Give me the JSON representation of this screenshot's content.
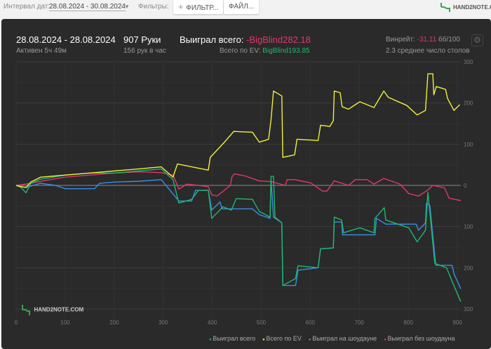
{
  "toolbar": {
    "interval_label": "Интервал дат:",
    "interval_value": "28.08.2024 - 30.08.2024",
    "filters_label": "Фильтры:",
    "filter_button": "ФИЛЬТР...",
    "file_button": "ФАЙЛ...",
    "brand": "HAND2NOTE.C"
  },
  "summary": {
    "date_range": "28.08.2024 - 28.08.2024",
    "active": "Активен 5ч 49м",
    "hands": "907 Руки",
    "hands_per_hour": "156 рук в час",
    "won_label": "Выиграл всего:",
    "won_value": "-BigBlind282.18",
    "ev_label": "Всего по EV:",
    "ev_value": "BigBlind193.85",
    "winrate_label": "Винрейт:",
    "winrate_value": "-31.11",
    "winrate_unit": "бб/100",
    "tables": "2.3 среднее число столов"
  },
  "watermark": "HAND2NOTE.COM",
  "colors": {
    "green": "#1fb870",
    "yellow": "#f0ef3c",
    "blue": "#3a8ee8",
    "pink": "#e0386b",
    "red": "#e0386b"
  },
  "chart_data": {
    "type": "line",
    "xlim": [
      0,
      910
    ],
    "ylim": [
      -300,
      300
    ],
    "x_ticks": [
      0,
      100,
      200,
      300,
      400,
      500,
      600,
      700,
      800,
      900
    ],
    "y_ticks": [
      300,
      200,
      100,
      0,
      -100,
      -200,
      -300
    ],
    "y_tick_labels": [
      "300",
      "200",
      "100",
      "0",
      "100",
      "200",
      "300"
    ],
    "series": [
      {
        "name": "Выиграл всего",
        "color": "#1fb870",
        "points": [
          [
            0,
            0
          ],
          [
            10,
            -5
          ],
          [
            20,
            -18
          ],
          [
            30,
            5
          ],
          [
            50,
            15
          ],
          [
            100,
            25
          ],
          [
            150,
            30
          ],
          [
            200,
            30
          ],
          [
            250,
            35
          ],
          [
            296,
            40
          ],
          [
            320,
            14
          ],
          [
            332,
            -43
          ],
          [
            358,
            -34
          ],
          [
            372,
            -12
          ],
          [
            392,
            -12
          ],
          [
            399,
            -80
          ],
          [
            422,
            -52
          ],
          [
            439,
            -60
          ],
          [
            449,
            -32
          ],
          [
            482,
            -34
          ],
          [
            496,
            -63
          ],
          [
            518,
            -77
          ],
          [
            520,
            22
          ],
          [
            525,
            22
          ],
          [
            528,
            -77
          ],
          [
            542,
            -91
          ],
          [
            544,
            -243
          ],
          [
            570,
            -226
          ],
          [
            575,
            -195
          ],
          [
            616,
            -200
          ],
          [
            621,
            -154
          ],
          [
            647,
            -152
          ],
          [
            649,
            -77
          ],
          [
            664,
            -84
          ],
          [
            668,
            -115
          ],
          [
            701,
            -103
          ],
          [
            730,
            -115
          ],
          [
            732,
            -80
          ],
          [
            751,
            -54
          ],
          [
            754,
            -84
          ],
          [
            801,
            -103
          ],
          [
            818,
            -137
          ],
          [
            835,
            -109
          ],
          [
            840,
            -17
          ],
          [
            847,
            -103
          ],
          [
            854,
            -189
          ],
          [
            878,
            -200
          ],
          [
            894,
            -246
          ],
          [
            907,
            -282
          ]
        ]
      },
      {
        "name": "Всего по EV",
        "color": "#f0ef3c",
        "points": [
          [
            0,
            0
          ],
          [
            10,
            -3
          ],
          [
            20,
            -5
          ],
          [
            30,
            8
          ],
          [
            50,
            20
          ],
          [
            100,
            25
          ],
          [
            150,
            30
          ],
          [
            200,
            35
          ],
          [
            250,
            40
          ],
          [
            296,
            45
          ],
          [
            320,
            20
          ],
          [
            329,
            52
          ],
          [
            392,
            37
          ],
          [
            396,
            68
          ],
          [
            425,
            105
          ],
          [
            444,
            131
          ],
          [
            482,
            129
          ],
          [
            496,
            105
          ],
          [
            515,
            112
          ],
          [
            520,
            160
          ],
          [
            525,
            229
          ],
          [
            542,
            217
          ],
          [
            544,
            68
          ],
          [
            568,
            74
          ],
          [
            573,
            112
          ],
          [
            616,
            109
          ],
          [
            621,
            146
          ],
          [
            640,
            143
          ],
          [
            647,
            157
          ],
          [
            649,
            229
          ],
          [
            661,
            225
          ],
          [
            665,
            191
          ],
          [
            678,
            185
          ],
          [
            701,
            203
          ],
          [
            730,
            189
          ],
          [
            750,
            229
          ],
          [
            759,
            214
          ],
          [
            797,
            194
          ],
          [
            818,
            171
          ],
          [
            835,
            182
          ],
          [
            840,
            271
          ],
          [
            850,
            271
          ],
          [
            852,
            220
          ],
          [
            857,
            240
          ],
          [
            876,
            233
          ],
          [
            880,
            211
          ],
          [
            893,
            182
          ],
          [
            905,
            196
          ]
        ]
      },
      {
        "name": "Выиграл на шоудауне",
        "color": "#3a8ee8",
        "points": [
          [
            0,
            0
          ],
          [
            20,
            -5
          ],
          [
            50,
            5
          ],
          [
            80,
            0
          ],
          [
            100,
            -8
          ],
          [
            160,
            -8
          ],
          [
            170,
            5
          ],
          [
            200,
            8
          ],
          [
            250,
            10
          ],
          [
            296,
            14
          ],
          [
            332,
            -38
          ],
          [
            358,
            -38
          ],
          [
            366,
            -12
          ],
          [
            392,
            -12
          ],
          [
            399,
            -60
          ],
          [
            416,
            -40
          ],
          [
            420,
            -57
          ],
          [
            482,
            -57
          ],
          [
            496,
            -71
          ],
          [
            518,
            -80
          ],
          [
            520,
            14
          ],
          [
            525,
            -77
          ],
          [
            542,
            -91
          ],
          [
            544,
            -243
          ],
          [
            570,
            -243
          ],
          [
            575,
            -206
          ],
          [
            616,
            -200
          ],
          [
            621,
            -154
          ],
          [
            647,
            -152
          ],
          [
            649,
            -89
          ],
          [
            664,
            -89
          ],
          [
            666,
            -120
          ],
          [
            732,
            -120
          ],
          [
            735,
            -80
          ],
          [
            754,
            -94
          ],
          [
            816,
            -94
          ],
          [
            821,
            -109
          ],
          [
            835,
            -91
          ],
          [
            837,
            -43
          ],
          [
            844,
            -49
          ],
          [
            856,
            -194
          ],
          [
            889,
            -194
          ],
          [
            894,
            -217
          ],
          [
            907,
            -251
          ]
        ]
      },
      {
        "name": "Выиграл без шоудауна",
        "color": "#e0386b",
        "points": [
          [
            0,
            0
          ],
          [
            30,
            5
          ],
          [
            60,
            12
          ],
          [
            100,
            20
          ],
          [
            150,
            25
          ],
          [
            200,
            30
          ],
          [
            250,
            33
          ],
          [
            296,
            31
          ],
          [
            320,
            25
          ],
          [
            332,
            -9
          ],
          [
            348,
            3
          ],
          [
            372,
            0
          ],
          [
            392,
            -3
          ],
          [
            399,
            -23
          ],
          [
            410,
            -26
          ],
          [
            437,
            0
          ],
          [
            440,
            20
          ],
          [
            445,
            28
          ],
          [
            467,
            23
          ],
          [
            496,
            11
          ],
          [
            520,
            9
          ],
          [
            549,
            0
          ],
          [
            553,
            14
          ],
          [
            568,
            14
          ],
          [
            601,
            6
          ],
          [
            625,
            -14
          ],
          [
            634,
            -14
          ],
          [
            649,
            11
          ],
          [
            678,
            0
          ],
          [
            692,
            14
          ],
          [
            716,
            14
          ],
          [
            730,
            3
          ],
          [
            750,
            17
          ],
          [
            783,
            3
          ],
          [
            801,
            -20
          ],
          [
            821,
            -26
          ],
          [
            840,
            -11
          ],
          [
            850,
            0
          ],
          [
            874,
            -6
          ],
          [
            883,
            -31
          ],
          [
            907,
            -37
          ]
        ]
      }
    ]
  }
}
